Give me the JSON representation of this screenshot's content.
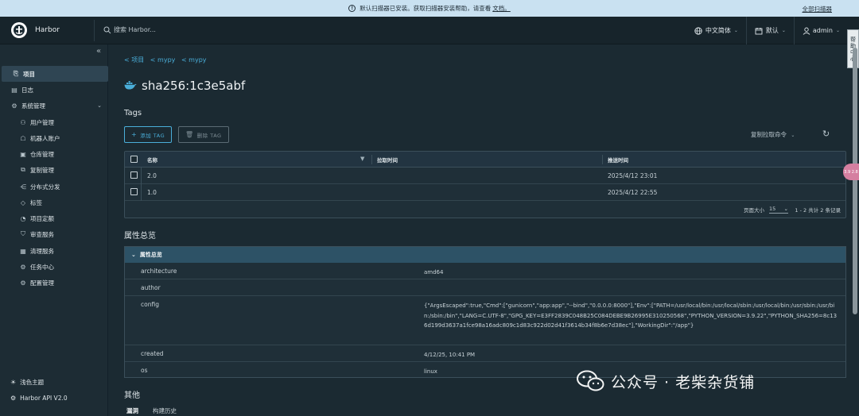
{
  "banner": {
    "message": "默认扫描器已安装。获取扫描器安装帮助，请查看",
    "link": "文档。",
    "right_link": "全部扫描器"
  },
  "header": {
    "brand": "Harbor",
    "search_placeholder": "搜索 Harbor...",
    "language": "中文简体",
    "theme": "默认",
    "user": "admin"
  },
  "side_tab": "帮助中心",
  "sidebar": {
    "items": [
      {
        "label": "项目",
        "icon": "projects-icon"
      },
      {
        "label": "日志",
        "icon": "logs-icon"
      },
      {
        "label": "系统管理",
        "icon": "admin-icon"
      },
      {
        "label": "用户管理",
        "icon": "users-icon"
      },
      {
        "label": "机器人账户",
        "icon": "robot-icon"
      },
      {
        "label": "仓库管理",
        "icon": "registry-icon"
      },
      {
        "label": "复制管理",
        "icon": "replication-icon"
      },
      {
        "label": "分布式分发",
        "icon": "distribution-icon"
      },
      {
        "label": "标签",
        "icon": "tag-icon"
      },
      {
        "label": "项目定额",
        "icon": "quota-icon"
      },
      {
        "label": "审查服务",
        "icon": "interrogation-icon"
      },
      {
        "label": "清理服务",
        "icon": "clean-icon"
      },
      {
        "label": "任务中心",
        "icon": "job-icon"
      },
      {
        "label": "配置管理",
        "icon": "config-icon"
      }
    ],
    "theme_toggle": "浅色主题",
    "api": "Harbor API V2.0"
  },
  "breadcrumb": [
    "< 项目",
    "< mypy",
    "< mypy"
  ],
  "title": "sha256:1c3e5abf",
  "tags_section": {
    "heading": "Tags",
    "add_btn": "添加 TAG",
    "delete_btn": "删除 TAG",
    "copy_pull": "复制拉取命令",
    "columns": [
      "名称",
      "拉取时间",
      "推送时间"
    ],
    "rows": [
      {
        "name": "2.0",
        "pull_time": "",
        "push_time": "2025/4/12 23:01"
      },
      {
        "name": "1.0",
        "pull_time": "",
        "push_time": "2025/4/12 22:55"
      }
    ],
    "page_size_label": "页面大小",
    "page_size": "15",
    "count": "1 - 2 共计 2 条记录"
  },
  "props_section": {
    "heading": "属性总览",
    "panel_title": "属性总览",
    "rows": [
      {
        "key": "architecture",
        "value": "amd64"
      },
      {
        "key": "author",
        "value": ""
      },
      {
        "key": "config",
        "value": "{\"ArgsEscaped\":true,\"Cmd\":[\"gunicorn\",\"app:app\",\"--bind\",\"0.0.0.0:8000\"],\"Env\":[\"PATH=/usr/local/bin:/usr/local/sbin:/usr/local/bin:/usr/sbin:/usr/bin:/sbin:/bin\",\"LANG=C.UTF-8\",\"GPG_KEY=E3FF2839C048B25C084DEBE9B26995E310250568\",\"PYTHON_VERSION=3.9.22\",\"PYTHON_SHA256=8c136d199d3637a1fce98a16adc809c1d83c922d02d41f3614b34f8b6e7d38ec\"],\"WorkingDir\":\"/app\"}"
      },
      {
        "key": "created",
        "value": "4/12/25, 10:41 PM"
      },
      {
        "key": "os",
        "value": "linux"
      }
    ]
  },
  "other_section": {
    "heading": "其他",
    "tabs": [
      "漏洞",
      "构建历史"
    ]
  },
  "float_btn": "3.9 2.8",
  "watermark": "公众号 · 老柴杂货铺",
  "colors": {
    "accent": "#4aaed9",
    "banner_bg": "#c9e1f1",
    "page_bg": "#1b2a32",
    "panel_header": "#2d5266"
  }
}
